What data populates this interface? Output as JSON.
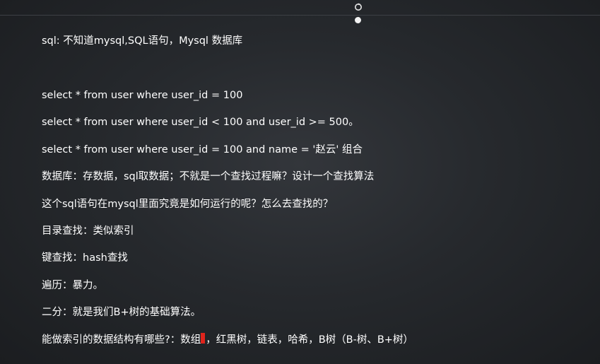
{
  "lines": [
    "sql: 不知道mysql,SQL语句，Mysql 数据库",
    "select * from user where  user_id = 100",
    "select * from user where user_id < 100  and user_id >= 500。",
    "select * from user where  user_id = 100 and name = '赵云' 组合",
    "数据库：存数据，sql取数据；不就是一个查找过程嘛？设计一个查找算法",
    "这个sql语句在mysql里面究竟是如何运行的呢？怎么去查找的？",
    "目录查找：类似索引",
    "键查找：hash查找",
    "遍历：暴力。",
    "二分：就是我们B+树的基础算法。"
  ],
  "last_line": {
    "before_cursor": "能做索引的数据结构有哪些?：数组",
    "after_cursor": "，红黑树，链表，哈希，B树（B-树、B+树）"
  },
  "icons": {
    "pointer": "refresh-pointer-icon",
    "cursor_color": "#e0241c"
  }
}
